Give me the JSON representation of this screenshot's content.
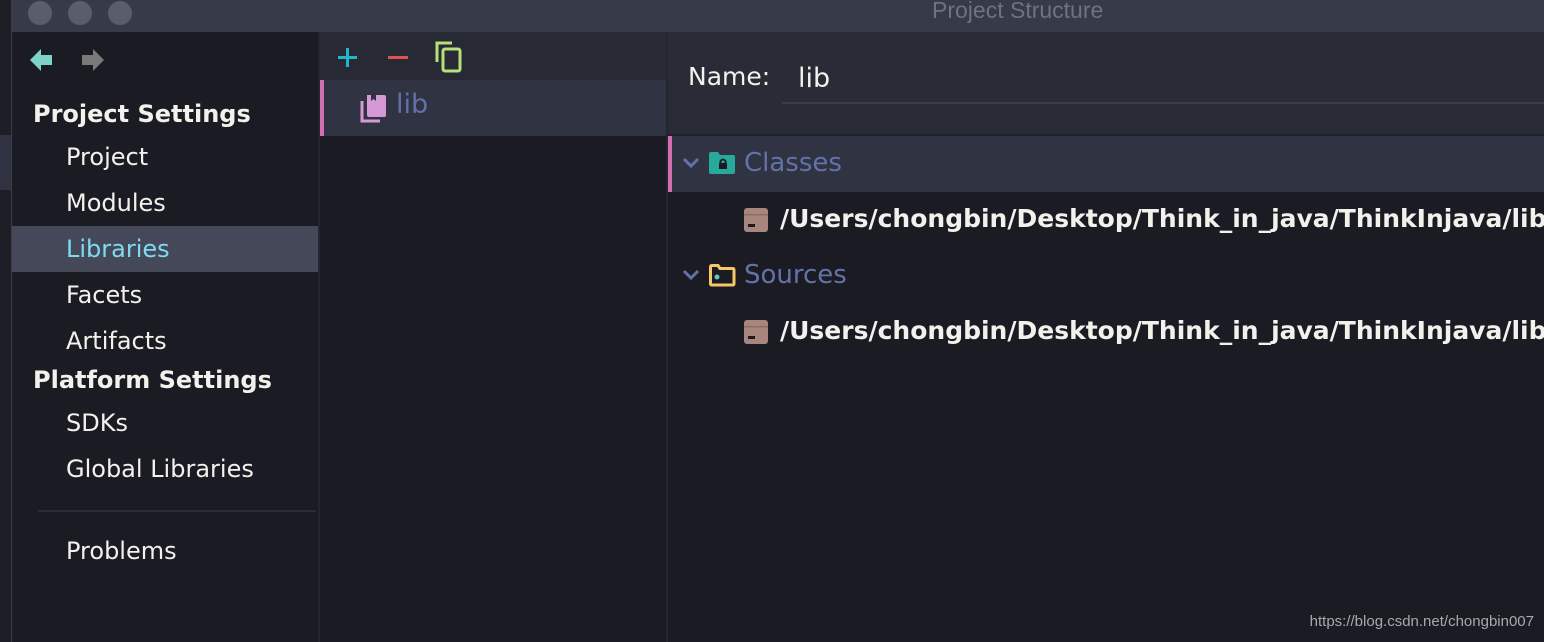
{
  "window": {
    "title": "Project Structure"
  },
  "colors": {
    "accent_selected_text": "#7fdbf0",
    "selection_bar": "#d36fae",
    "add": "#1fb6c9",
    "remove": "#e0544f",
    "copy": "#b5e07a",
    "library_icon": "#d49ad8",
    "classes_folder": "#27a99b",
    "sources_folder": "#f5c865",
    "jar": "#a8867e"
  },
  "navigation": {
    "back_icon": "arrow-left-icon",
    "forward_icon": "arrow-right-icon"
  },
  "sidebar": {
    "project_settings_header": "Project Settings",
    "project_settings_items": [
      {
        "label": "Project",
        "selected": false
      },
      {
        "label": "Modules",
        "selected": false
      },
      {
        "label": "Libraries",
        "selected": true
      },
      {
        "label": "Facets",
        "selected": false
      },
      {
        "label": "Artifacts",
        "selected": false
      }
    ],
    "platform_settings_header": "Platform Settings",
    "platform_settings_items": [
      {
        "label": "SDKs",
        "selected": false
      },
      {
        "label": "Global Libraries",
        "selected": false
      }
    ],
    "problems_label": "Problems"
  },
  "library_list": {
    "toolbar": {
      "add_icon": "plus-icon",
      "remove_icon": "minus-icon",
      "copy_icon": "copy-icon"
    },
    "items": [
      {
        "label": "lib",
        "selected": true
      }
    ]
  },
  "details": {
    "name_label": "Name:",
    "name_value": "lib",
    "tree": [
      {
        "label": "Classes",
        "icon": "classes-folder-icon",
        "expanded": true,
        "selected": true,
        "children": [
          "/Users/chongbin/Desktop/Think_in_java/ThinkInjava/lib"
        ]
      },
      {
        "label": "Sources",
        "icon": "sources-folder-icon",
        "expanded": true,
        "selected": false,
        "children": [
          "/Users/chongbin/Desktop/Think_in_java/ThinkInjava/lib"
        ]
      }
    ]
  },
  "watermark": "https://blog.csdn.net/chongbin007"
}
